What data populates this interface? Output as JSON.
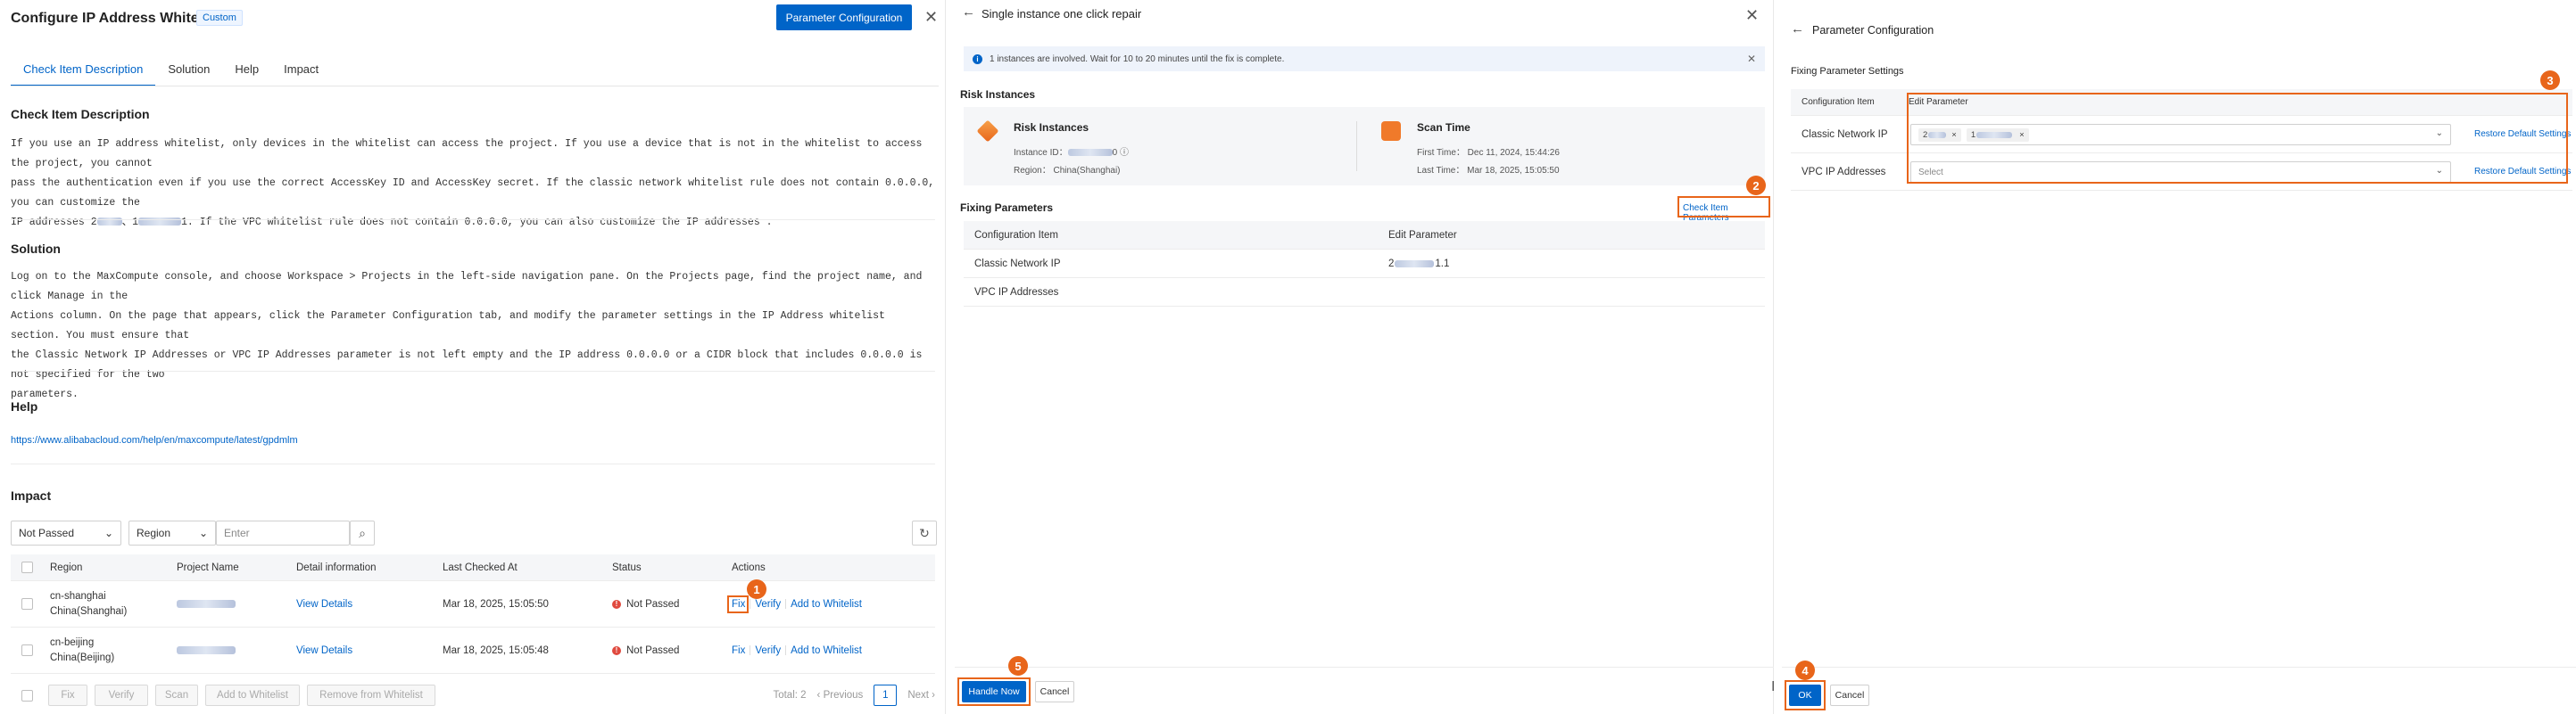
{
  "panel1": {
    "title": "Configure IP Address Whitelist",
    "tag": "Custom",
    "param_button": "Parameter Configuration",
    "tabs": [
      "Check Item Description",
      "Solution",
      "Help",
      "Impact"
    ],
    "check_item": {
      "heading": "Check Item Description",
      "line1": "If you use an IP address whitelist, only devices in the whitelist can access the project. If you use a device that is not in the whitelist to access the project, you cannot",
      "line2": "pass the authentication even if you use the correct AccessKey ID and AccessKey secret. If the classic network whitelist rule does not contain 0.0.0.0, you can customize the",
      "line3_pre": "IP addresses 2",
      "line3_mid": "、1",
      "line3_post": "1. If the VPC whitelist rule does not contain 0.0.0.0, you can also customize the IP addresses ."
    },
    "solution": {
      "heading": "Solution",
      "line1": "Log on to the MaxCompute console, and choose Workspace > Projects in the left-side navigation pane. On the Projects page, find the project name, and click Manage in the",
      "line2": "Actions column. On the page that appears, click the Parameter Configuration tab, and modify the parameter settings in the IP Address whitelist section. You must ensure that",
      "line3": "the Classic Network IP Addresses or VPC IP Addresses parameter is not left empty and the IP address 0.0.0.0 or a CIDR block that includes 0.0.0.0 is not specified for the two",
      "line4": "parameters."
    },
    "help": {
      "heading": "Help",
      "link": "https://www.alibabacloud.com/help/en/maxcompute/latest/gpdmlm"
    },
    "impact": {
      "heading": "Impact",
      "filter_status": "Not Passed",
      "filter_region": "Region",
      "filter_placeholder": "Enter",
      "columns": [
        "Region",
        "Project Name",
        "Detail information",
        "Last Checked At",
        "Status",
        "Actions"
      ],
      "rows": [
        {
          "region1": "cn-shanghai",
          "region2": "China(Shanghai)",
          "detail": "View Details",
          "checked": "Mar 18, 2025, 15:05:50",
          "status": "Not Passed",
          "fix": "Fix",
          "verify": "Verify",
          "whitelist": "Add to Whitelist"
        },
        {
          "region1": "cn-beijing",
          "region2": "China(Beijing)",
          "detail": "View Details",
          "checked": "Mar 18, 2025, 15:05:48",
          "status": "Not Passed",
          "fix": "Fix",
          "verify": "Verify",
          "whitelist": "Add to Whitelist"
        }
      ],
      "bulk": [
        "Fix",
        "Verify",
        "Scan",
        "Add to Whitelist",
        "Remove from Whitelist"
      ],
      "total": "Total: 2",
      "prev": "Previous",
      "page": "1",
      "next": "Next"
    }
  },
  "panel2": {
    "title": "Single instance one click repair",
    "info": "1 instances are involved. Wait for 10 to 20 minutes until the fix is complete.",
    "risk_heading": "Risk Instances",
    "risk_title": "Risk Instances",
    "instance_id_label": "Instance ID：",
    "instance_id_tail": "0",
    "region": "Region： China(Shanghai)",
    "scan_title": "Scan Time",
    "first_time": "First Time： Dec 11, 2024, 15:44:26",
    "last_time": "Last Time： Mar 18, 2025, 15:05:50",
    "fixing_heading": "Fixing Parameters",
    "check_params_link": "Check Item Parameters",
    "columns": [
      "Configuration Item",
      "Edit Parameter"
    ],
    "rows": [
      {
        "item": "Classic Network IP",
        "value_pre": "2",
        "value_post": "1.1"
      },
      {
        "item": "VPC IP Addresses",
        "value_pre": "",
        "value_post": ""
      }
    ],
    "handle_button": "Handle Now",
    "cancel_button": "Cancel"
  },
  "panel3": {
    "title": "Parameter Configuration",
    "section": "Fixing Parameter Settings",
    "columns": [
      "Configuration Item",
      "Edit Parameter"
    ],
    "rows": [
      {
        "item": "Classic Network IP",
        "chip1": "2",
        "chip2": "1",
        "restore": "Restore Default Settings"
      },
      {
        "item": "VPC IP Addresses",
        "placeholder": "Select",
        "restore": "Restore Default Settings"
      }
    ],
    "ok_button": "OK",
    "cancel_button": "Cancel",
    "cursor": "I"
  },
  "badges": [
    "1",
    "2",
    "3",
    "4",
    "5"
  ],
  "colors": {
    "primary": "#0064c8",
    "callout": "#e8651a",
    "danger": "#e04a3f"
  }
}
